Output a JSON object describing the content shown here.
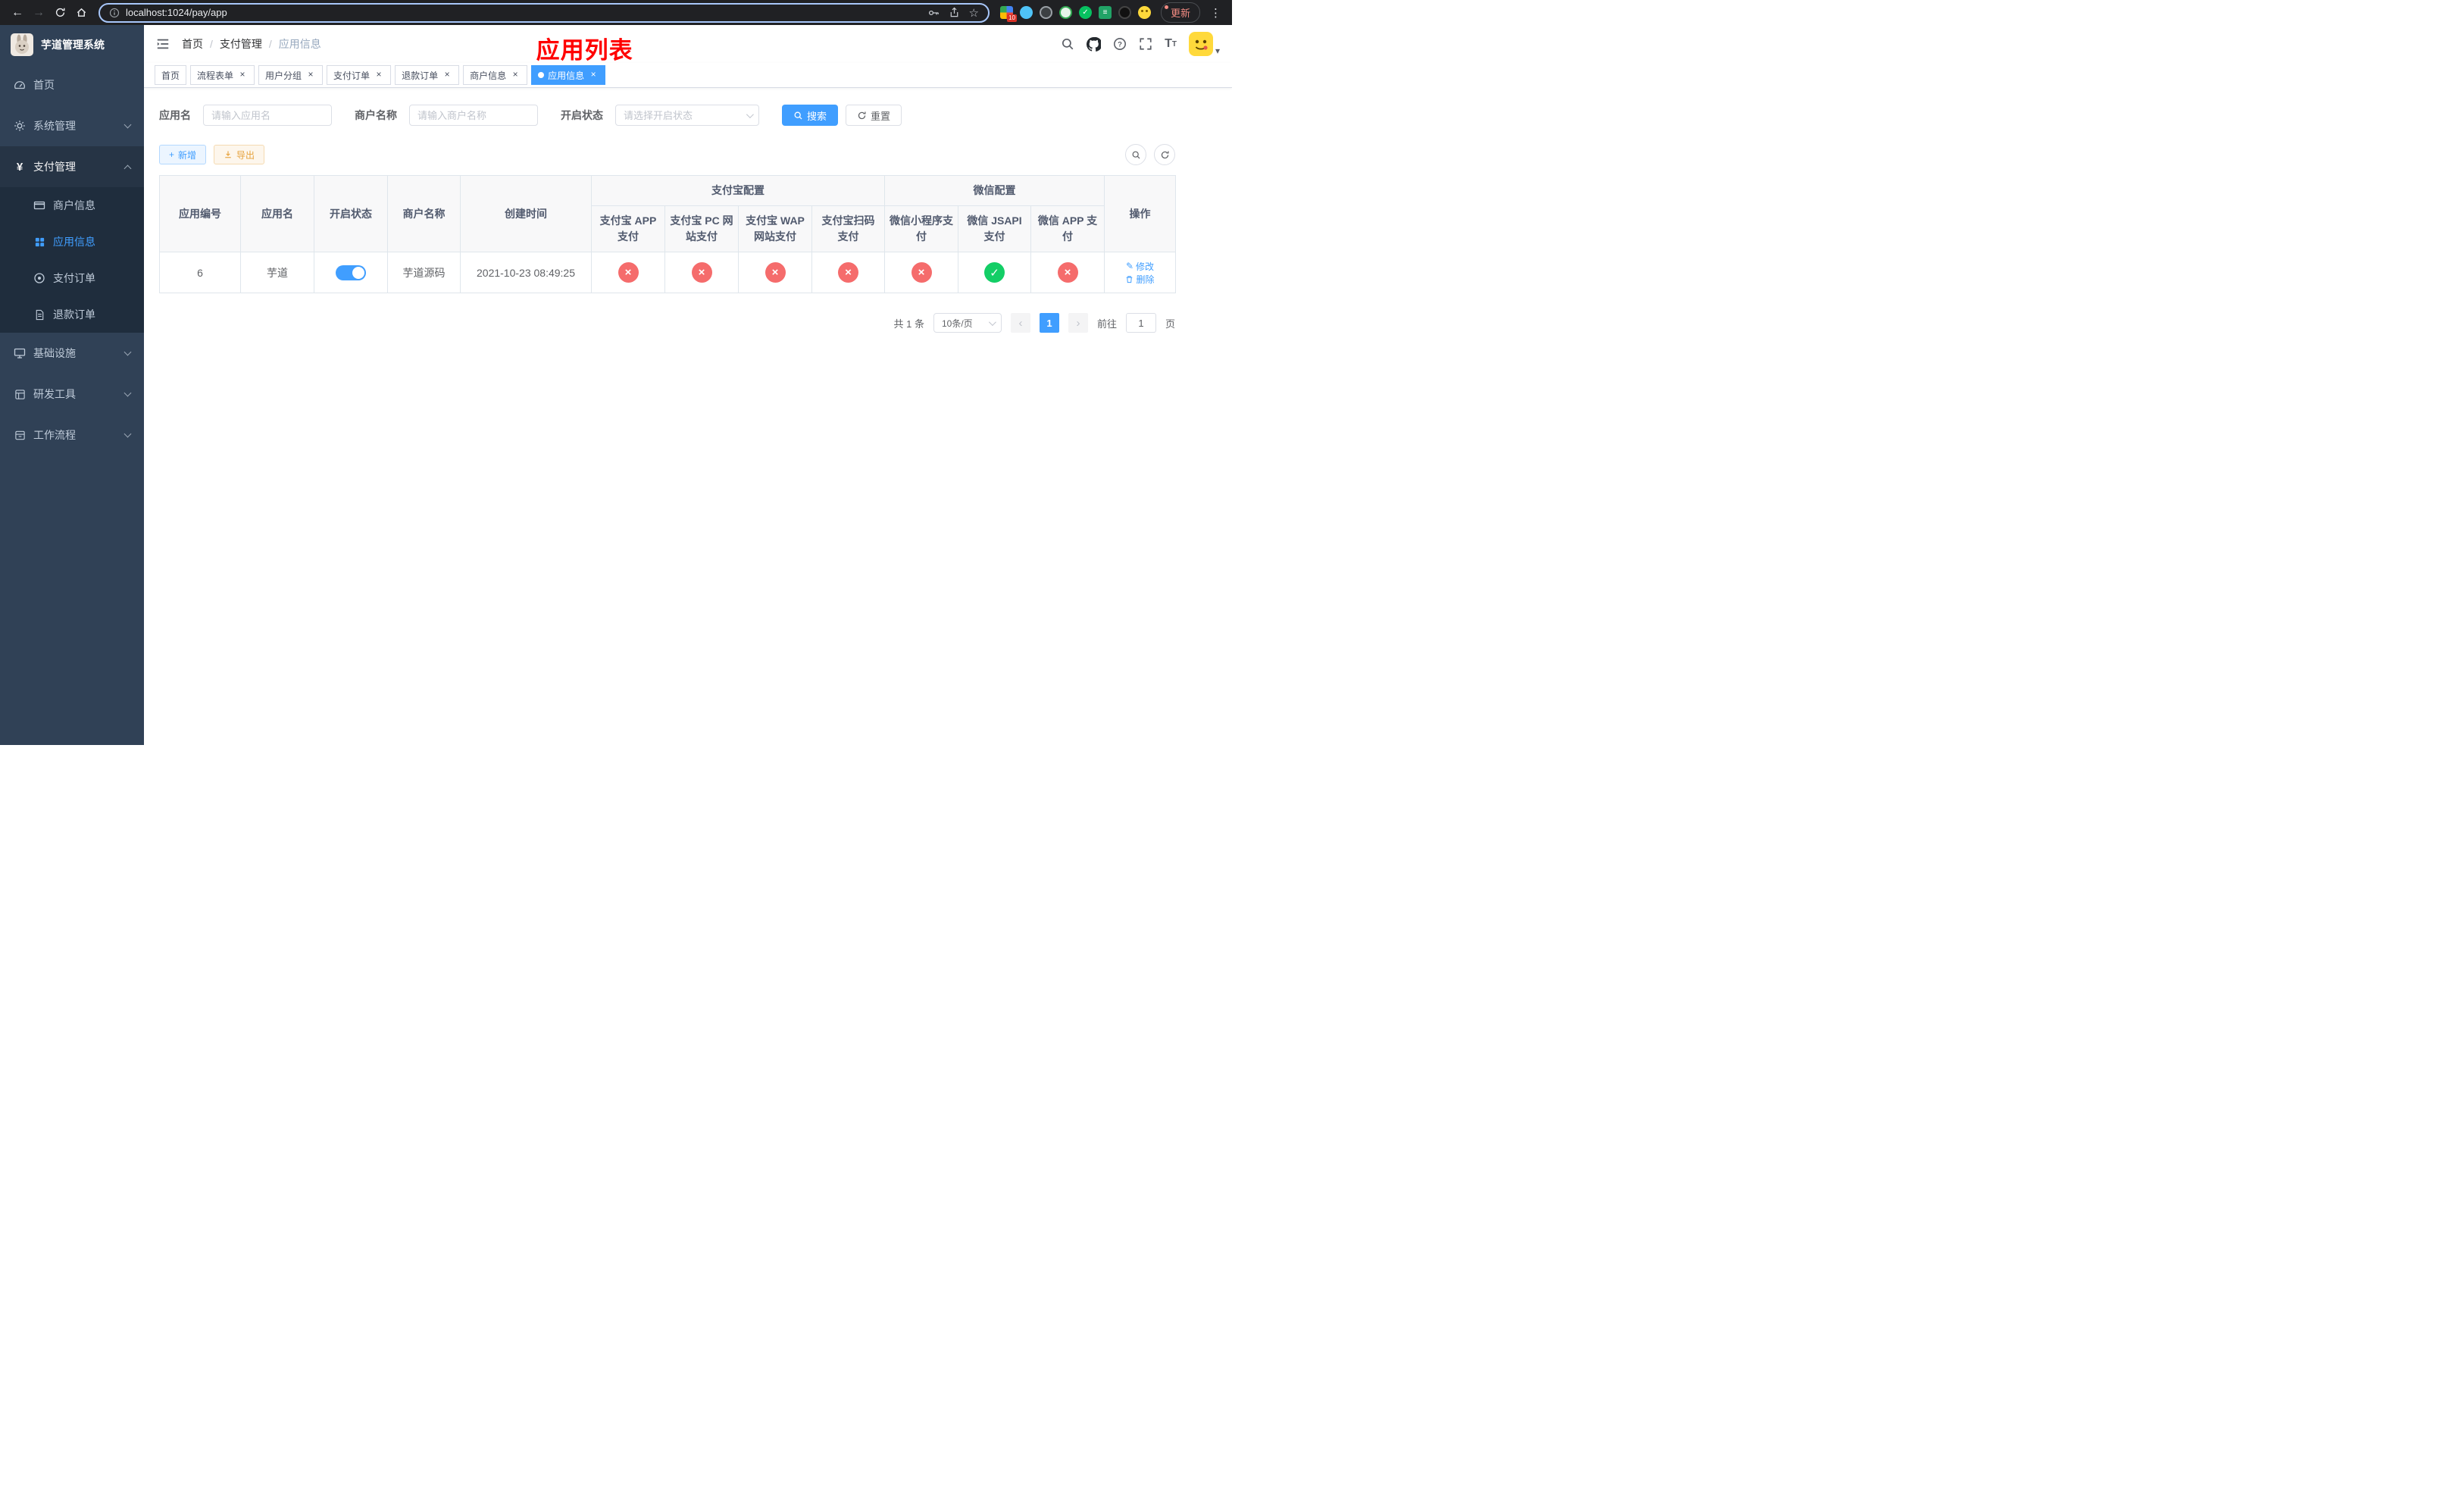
{
  "colors": {
    "accent": "#409eff",
    "title_red": "#ff0000",
    "danger": "#f56c6c",
    "success": "#13ce66",
    "warning": "#e6a23c",
    "sidebar_bg": "#304156",
    "sidebar_sub_bg": "#1f2d3d"
  },
  "icons": {
    "back": "←",
    "forward": "→",
    "star": "☆",
    "more": "⋮",
    "close": "×",
    "check": "✓",
    "cross": "×",
    "plus": "+",
    "yen": "¥",
    "pencil": "✎",
    "prev": "‹",
    "next": "›",
    "caret_down": "▾",
    "wechat_check": "✓"
  },
  "browser": {
    "url": "localhost:1024/pay/app",
    "update_button": "更新",
    "extension_badge": "10"
  },
  "sidebar": {
    "title": "芋道管理系统",
    "items": [
      {
        "label": "首页"
      },
      {
        "label": "系统管理"
      },
      {
        "label": "支付管理"
      },
      {
        "label": "基础设施"
      },
      {
        "label": "研发工具"
      },
      {
        "label": "工作流程"
      }
    ],
    "payment_children": [
      {
        "label": "商户信息"
      },
      {
        "label": "应用信息"
      },
      {
        "label": "支付订单"
      },
      {
        "label": "退款订单"
      }
    ]
  },
  "header": {
    "breadcrumb": [
      "首页",
      "支付管理",
      "应用信息"
    ],
    "separator": "/",
    "title": "应用列表"
  },
  "tabs": [
    {
      "label": "首页"
    },
    {
      "label": "流程表单"
    },
    {
      "label": "用户分组"
    },
    {
      "label": "支付订单"
    },
    {
      "label": "退款订单"
    },
    {
      "label": "商户信息"
    },
    {
      "label": "应用信息"
    }
  ],
  "filters": {
    "app_name": {
      "label": "应用名",
      "placeholder": "请输入应用名"
    },
    "merchant_name": {
      "label": "商户名称",
      "placeholder": "请输入商户名称"
    },
    "status": {
      "label": "开启状态",
      "placeholder": "请选择开启状态"
    },
    "search": "搜索",
    "reset": "重置"
  },
  "toolbar": {
    "add": "新增",
    "export": "导出"
  },
  "table": {
    "headers": {
      "app_id": "应用编号",
      "app_name": "应用名",
      "status": "开启状态",
      "merchant_name": "商户名称",
      "create_time": "创建时间",
      "alipay_group": "支付宝配置",
      "alipay": [
        "支付宝 APP 支付",
        "支付宝 PC 网站支付",
        "支付宝 WAP 网站支付",
        "支付宝扫码支付"
      ],
      "wechat_group": "微信配置",
      "wechat": [
        "微信小程序支付",
        "微信 JSAPI 支付",
        "微信 APP 支付"
      ],
      "ops": "操作"
    },
    "row": {
      "app_id": "6",
      "app_name": "芋道",
      "status_on": true,
      "merchant_name": "芋道源码",
      "create_time": "2021-10-23 08:49:25",
      "configs": [
        false,
        false,
        false,
        false,
        false,
        true,
        false
      ],
      "edit": "修改",
      "delete": "删除"
    }
  },
  "pagination": {
    "total": "共 1 条",
    "page_size": "10条/页",
    "page": "1",
    "goto_label": "前往",
    "goto_value": "1",
    "page_label": "页"
  }
}
